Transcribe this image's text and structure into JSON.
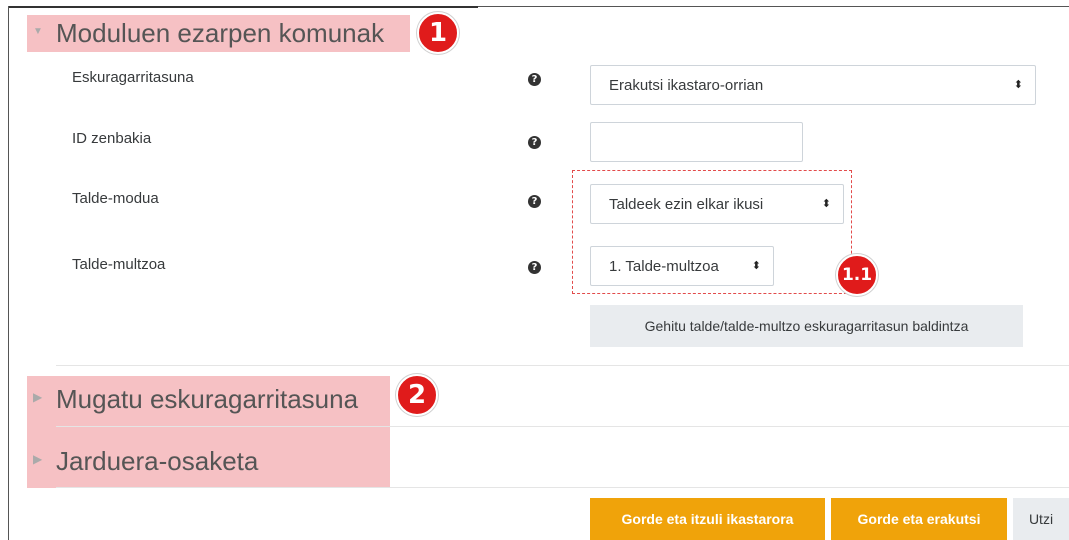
{
  "sections": {
    "common": {
      "title": "Moduluen ezarpen komunak",
      "badge": "1"
    },
    "restrict": {
      "title": "Mugatu eskuragarritasuna",
      "badge": "2"
    },
    "completion": {
      "title": "Jarduera-osaketa"
    }
  },
  "badge_group": "1.1",
  "fields": {
    "availability": {
      "label": "Eskuragarritasuna",
      "value": "Erakutsi ikastaro-orrian"
    },
    "idnumber": {
      "label": "ID zenbakia",
      "value": ""
    },
    "groupmode": {
      "label": "Talde-modua",
      "value": "Taldeek ezin elkar ikusi"
    },
    "grouping": {
      "label": "Talde-multzoa",
      "value": "1. Talde-multzoa"
    }
  },
  "help_glyph": "?",
  "select_arrow": "⬍",
  "caret_open": "▼",
  "caret_closed": "▶",
  "add_restriction_button": "Gehitu talde/talde-multzo eskuragarritasun baldintza",
  "footer": {
    "save_return": "Gorde eta itzuli ikastarora",
    "save_display": "Gorde eta erakutsi",
    "cancel": "Utzi"
  },
  "colors": {
    "highlight": "#f6c1c4",
    "badge": "#e01b1b",
    "primary": "#f0a30a"
  },
  "icons": [
    "help-icon",
    "select-arrow-icon",
    "expand-caret-icon",
    "collapse-caret-icon"
  ]
}
